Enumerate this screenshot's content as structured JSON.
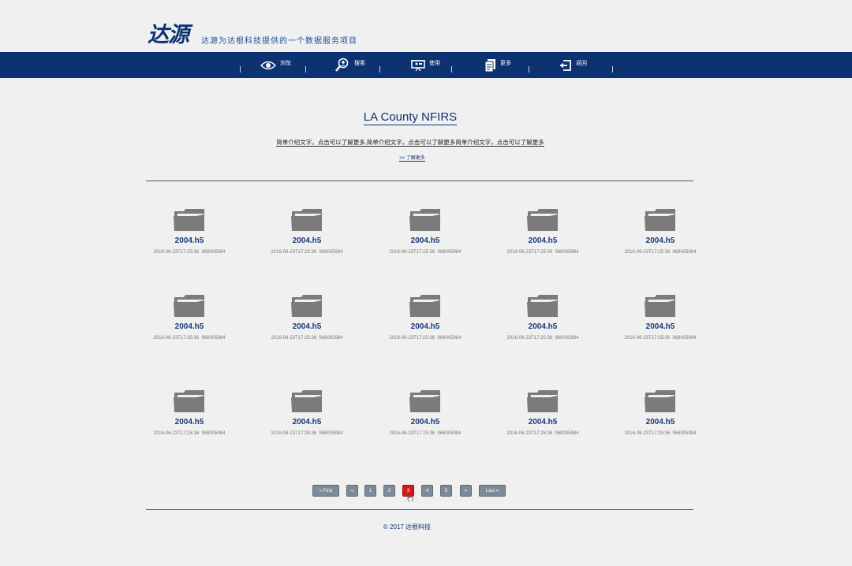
{
  "header": {
    "logo": "达源",
    "tagline": "达源为达根科技提供的一个数据服务项目"
  },
  "nav": {
    "items": [
      {
        "label": "浏览",
        "icon": "eye-icon"
      },
      {
        "label": "搜索",
        "icon": "search-user-icon"
      },
      {
        "label": "使用",
        "icon": "presentation-icon"
      },
      {
        "label": "更多",
        "icon": "document-icon"
      },
      {
        "label": "返回",
        "icon": "back-exit-icon"
      }
    ]
  },
  "intro": {
    "title": "LA County NFIRS",
    "description": "简单介绍文字，点击可以了解更多,简单介绍文字，点击可以了解更多简单介绍文字，点击可以了解更多",
    "more_link": ">>  了解更多"
  },
  "files": [
    {
      "name": "2004.h5",
      "date": "2016-06-23T17:25:36",
      "size": "968005984"
    },
    {
      "name": "2004.h5",
      "date": "2016-06-23T17:25:36",
      "size": "968005984"
    },
    {
      "name": "2004.h5",
      "date": "2016-06-23T17:25:36",
      "size": "968005984"
    },
    {
      "name": "2004.h5",
      "date": "2016-06-23T17:25:36",
      "size": "968005984"
    },
    {
      "name": "2004.h5",
      "date": "2016-06-23T17:25:36",
      "size": "968005984"
    },
    {
      "name": "2004.h5",
      "date": "2016-06-23T17:25:36",
      "size": "968005984"
    },
    {
      "name": "2004.h5",
      "date": "2016-06-23T17:25:36",
      "size": "968005984"
    },
    {
      "name": "2004.h5",
      "date": "2016-06-23T17:25:36",
      "size": "968005984"
    },
    {
      "name": "2004.h5",
      "date": "2016-06-23T17:25:36",
      "size": "968005984"
    },
    {
      "name": "2004.h5",
      "date": "2016-06-23T17:25:36",
      "size": "968005984"
    },
    {
      "name": "2004.h5",
      "date": "2016-06-23T17:25:36",
      "size": "968005984"
    },
    {
      "name": "2004.h5",
      "date": "2016-06-23T17:25:36",
      "size": "968005984"
    },
    {
      "name": "2004.h5",
      "date": "2016-06-23T17:25:36",
      "size": "968005984"
    },
    {
      "name": "2004.h5",
      "date": "2016-06-23T17:25:36",
      "size": "968005984"
    },
    {
      "name": "2004.h5",
      "date": "2016-06-23T17:25:36",
      "size": "968005984"
    }
  ],
  "pagination": {
    "first": "« First",
    "prev": "«",
    "pages": [
      "1",
      "2",
      "3",
      "4",
      "5"
    ],
    "current": "3",
    "next": "»",
    "last": "Last »"
  },
  "footer": {
    "copyright": "© 2017 达根科技"
  },
  "colors": {
    "brand": "#0d3272",
    "active_page": "#d61a1a",
    "folder": "#7b7b7b"
  }
}
